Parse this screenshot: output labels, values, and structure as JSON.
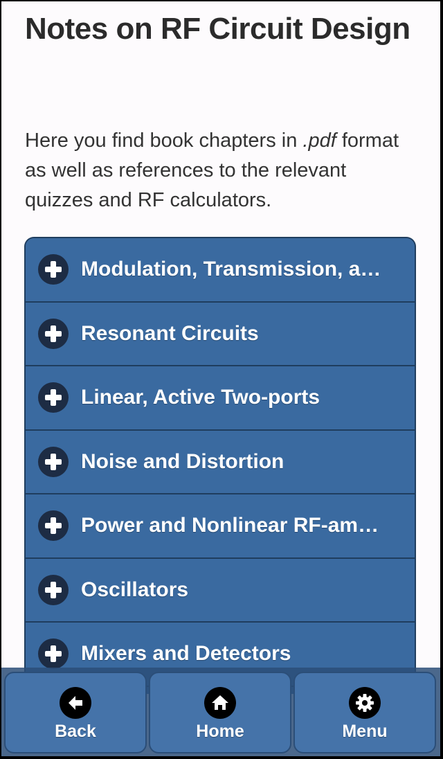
{
  "page": {
    "title": "Notes on RF Circuit Design",
    "intro_before": "Here you find book chapters in ",
    "intro_italic": ".pdf",
    "intro_after": " format as well as references to the relevant quizzes and RF calculators."
  },
  "accordion": {
    "items": [
      {
        "label": "Modulation, Transmission, and Reception",
        "icon": "plus-icon"
      },
      {
        "label": "Resonant Circuits",
        "icon": "plus-icon"
      },
      {
        "label": "Linear, Active Two-ports",
        "icon": "plus-icon"
      },
      {
        "label": "Noise and Distortion",
        "icon": "plus-icon"
      },
      {
        "label": "Power and Nonlinear RF-amplifiers",
        "icon": "plus-icon"
      },
      {
        "label": "Oscillators",
        "icon": "plus-icon"
      },
      {
        "label": "Mixers and Detectors",
        "icon": "plus-icon"
      }
    ]
  },
  "footer": {
    "back_label": "Back",
    "home_label": "Home",
    "menu_label": "Menu",
    "icons": [
      "arrow-left-icon",
      "home-icon",
      "gear-icon"
    ]
  },
  "colors": {
    "accent": "#3a6aa0",
    "accent_border": "#1f3d5e",
    "footer_button": "#4573a9",
    "icon_circle": "#1d2c44",
    "title_text": "#2b2b2b"
  }
}
